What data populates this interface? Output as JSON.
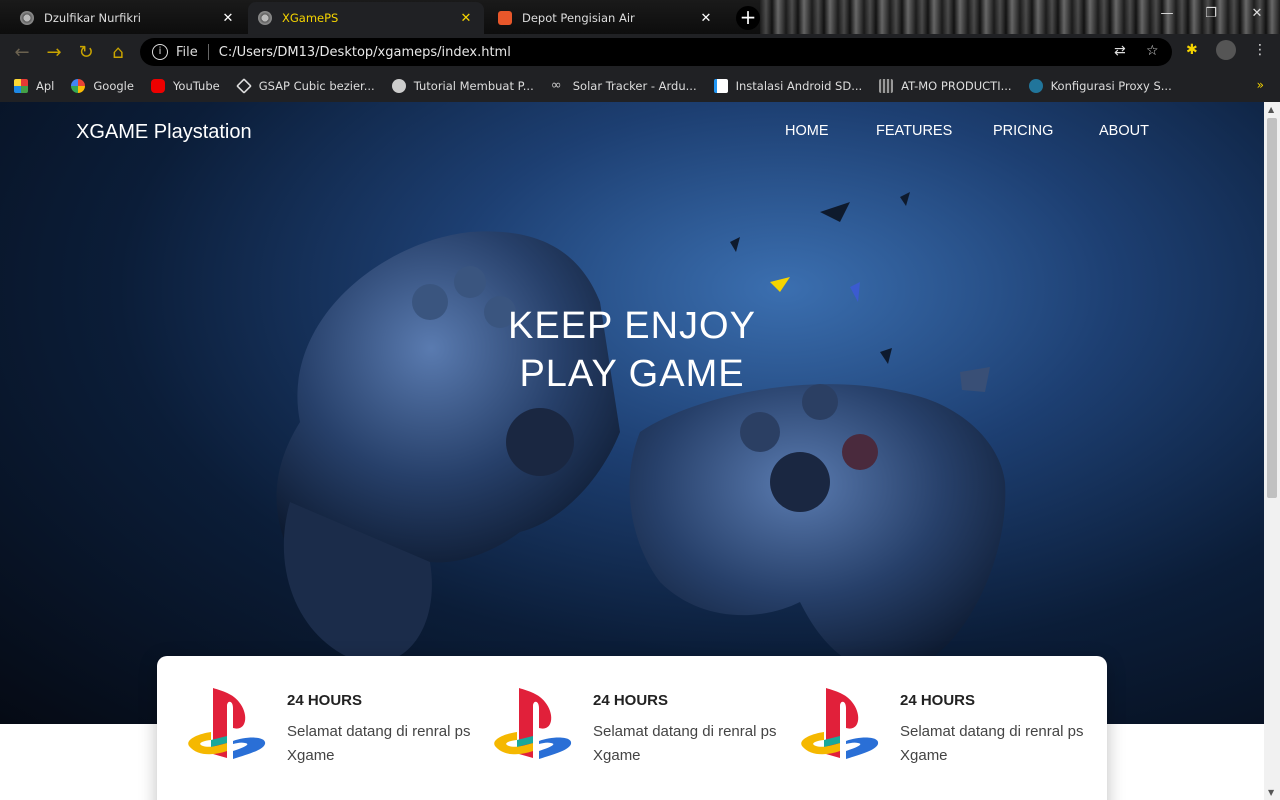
{
  "browser": {
    "tabs": [
      {
        "title": "Dzulfikar Nurfikri",
        "active": false
      },
      {
        "title": "XGamePS",
        "active": true
      },
      {
        "title": "Depot Pengisian Air",
        "active": false
      }
    ],
    "address": {
      "scheme_label": "File",
      "url": "C:/Users/DM13/Desktop/xgameps/index.html"
    },
    "bookmarks": [
      {
        "label": "Apl",
        "icon": "apps-grid-icon"
      },
      {
        "label": "Google",
        "icon": "google-icon"
      },
      {
        "label": "YouTube",
        "icon": "youtube-icon"
      },
      {
        "label": "GSAP Cubic bezier...",
        "icon": "codepen-icon"
      },
      {
        "label": "Tutorial Membuat P...",
        "icon": "globe-icon"
      },
      {
        "label": "Solar Tracker - Ardu...",
        "icon": "infinity-icon"
      },
      {
        "label": "Instalasi Android SD...",
        "icon": "page-icon"
      },
      {
        "label": "AT-MO PRODUCTI...",
        "icon": "film-icon"
      },
      {
        "label": "Konfigurasi Proxy S...",
        "icon": "wordpress-icon"
      }
    ],
    "colors": {
      "tab_accent": "#f5d400",
      "chrome_bg": "#202124"
    }
  },
  "page": {
    "brand": "XGAME Playstation",
    "nav": [
      "HOME",
      "FEATURES",
      "PRICING",
      "ABOUT"
    ],
    "headline": {
      "line1": "KEEP ENJOY",
      "line2": "PLAY GAME"
    },
    "features": [
      {
        "title": "24 HOURS",
        "desc": "Selamat datang di renral ps Xgame",
        "icon": "playstation-logo-icon"
      },
      {
        "title": "24 HOURS",
        "desc": "Selamat datang di renral ps Xgame",
        "icon": "playstation-logo-icon"
      },
      {
        "title": "24 HOURS",
        "desc": "Selamat datang di renral ps Xgame",
        "icon": "playstation-logo-icon"
      }
    ]
  }
}
